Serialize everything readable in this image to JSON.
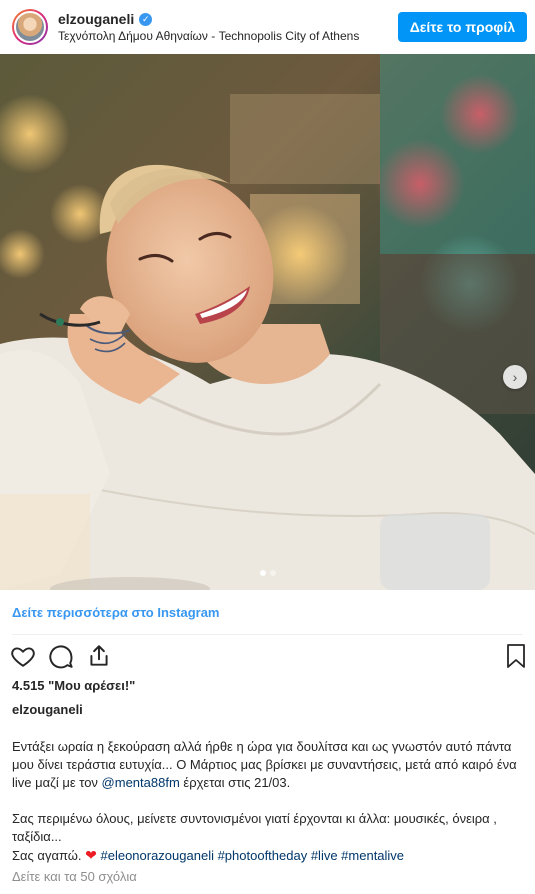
{
  "header": {
    "username": "elzouganeli",
    "verified_icon": "verified-badge-icon",
    "location": "Τεχνόπολη Δήμου Αθηναίων - Technopolis City of Athens",
    "profile_button": "Δείτε το προφίλ"
  },
  "carousel": {
    "next_icon": "chevron-right-icon",
    "total_slides": 2,
    "current_slide": 1
  },
  "more_link": "Δείτε περισσότερα στο Instagram",
  "actions": {
    "like_icon": "heart-outline-icon",
    "comment_icon": "comment-bubble-icon",
    "share_icon": "share-upload-icon",
    "save_icon": "bookmark-icon"
  },
  "likes": "4.515 \"Μου αρέσει!\"",
  "caption": {
    "username": "elzouganeli",
    "line1": "Εντάξει ωραία η ξεκούραση αλλά ήρθε η ώρα για δουλίτσα και ως γνωστόν αυτό πάντα μου δίνει τεράστια ευτυχία... Ο Μάρτιος μας βρίσκει με συναντήσεις, μετά από καιρό ένα live μαζί με τον ",
    "mention": "@menta88fm",
    "line1_end": " έρχεται στις 21/03.",
    "line2": "Σας περιμένω όλους, μείνετε συντονισμένοι γιατί έρχονται κι άλλα: μουσικές, όνειρα , ταξίδια...",
    "line3_start": "Σας αγαπώ. ",
    "heart": "❤",
    "hashtags": "#eleonorazouganeli #photooftheday #live #mentalive"
  },
  "comments_link": "Δείτε και τα 50 σχόλια",
  "colors": {
    "accent": "#0095f6",
    "link": "#3897f0",
    "hashtag": "#00376b",
    "muted": "#8e8e8e"
  }
}
